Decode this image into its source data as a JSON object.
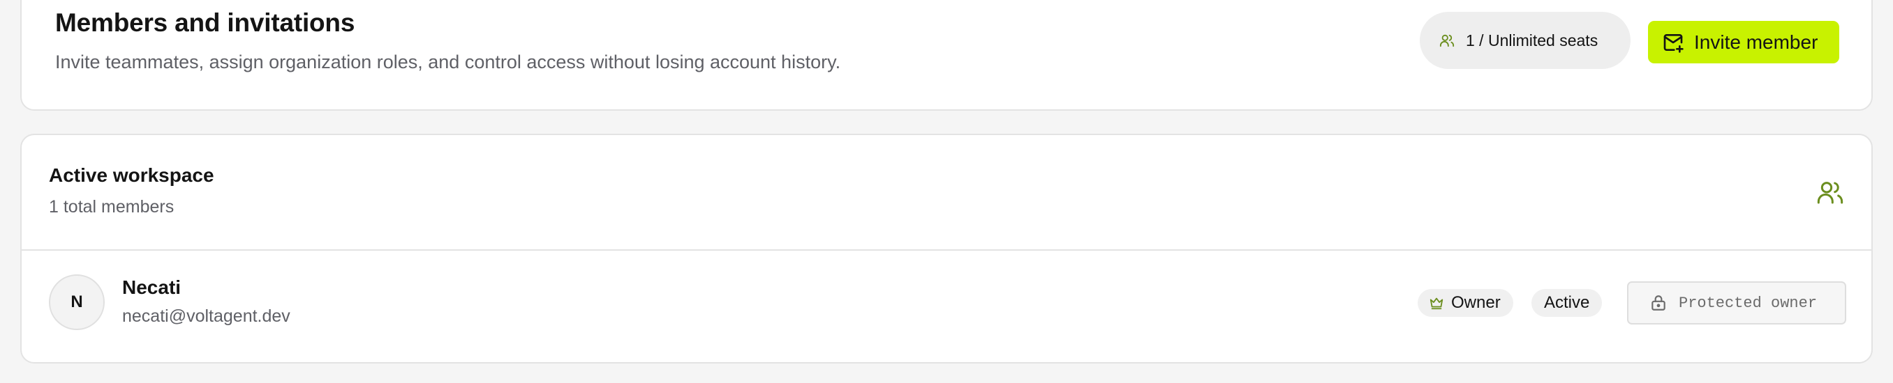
{
  "header": {
    "title": "Members and invitations",
    "subtitle": "Invite teammates, assign organization roles, and control access without losing account history.",
    "seats_label": "1 / Unlimited seats",
    "seats_icon": "users-icon",
    "invite_label": "Invite member",
    "invite_icon": "mail-plus-icon"
  },
  "workspace": {
    "title": "Active workspace",
    "count_label": "1 total members",
    "icon": "users-icon"
  },
  "members": [
    {
      "initial": "N",
      "name": "Necati",
      "email": "necati@voltagent.dev",
      "role": "Owner",
      "role_icon": "crown-icon",
      "status": "Active",
      "action_label": "Protected owner",
      "action_icon": "lock-icon"
    }
  ],
  "colors": {
    "accent": "#c8f200",
    "icon_green": "#6b8e1e",
    "muted_text": "#5f6066",
    "border": "#e3e3e3"
  }
}
